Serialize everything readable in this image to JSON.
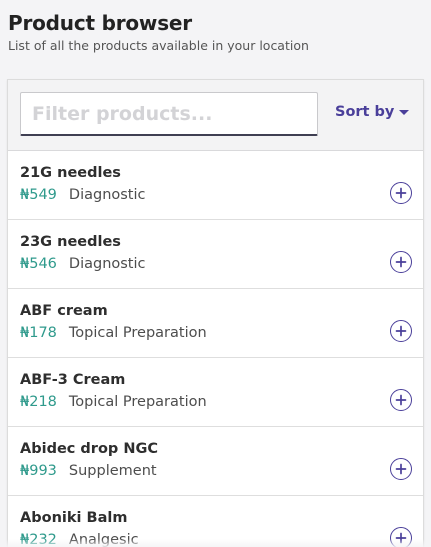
{
  "header": {
    "title": "Product browser",
    "subtitle": "List of all the products available in your location"
  },
  "toolbar": {
    "filter_placeholder": "Filter products...",
    "filter_value": "",
    "sort_label": "Sort by"
  },
  "products": [
    {
      "name": "21G needles",
      "price": "₦549",
      "category": "Diagnostic"
    },
    {
      "name": "23G needles",
      "price": "₦546",
      "category": "Diagnostic"
    },
    {
      "name": "ABF cream",
      "price": "₦178",
      "category": "Topical Preparation"
    },
    {
      "name": "ABF-3 Cream",
      "price": "₦218",
      "category": "Topical Preparation"
    },
    {
      "name": "Abidec drop NGC",
      "price": "₦993",
      "category": "Supplement"
    },
    {
      "name": "Aboniki Balm",
      "price": "₦232",
      "category": "Analgesic"
    }
  ],
  "icons": {
    "sort": "caret-down-icon",
    "add": "plus-circle-icon"
  },
  "colors": {
    "accent": "#4a3f9a",
    "price": "#2f9a8c",
    "background": "#f4f4f6"
  }
}
